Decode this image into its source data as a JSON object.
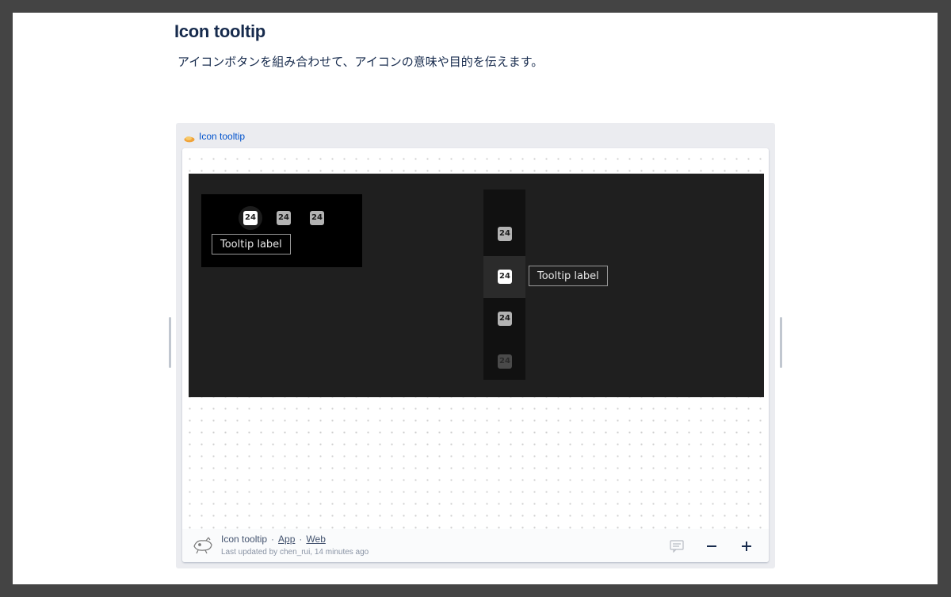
{
  "page": {
    "title": "Icon tooltip",
    "description": "アイコンボタンを組み合わせて、アイコンの意味や目的を伝えます。"
  },
  "embed": {
    "link_label": "Icon tooltip",
    "logo_icon": "figma-logo-icon"
  },
  "frame": {
    "horizontal_group": {
      "icons": [
        "24",
        "24",
        "24"
      ],
      "active_index": 0,
      "tooltip_label": "Tooltip label"
    },
    "vertical_group": {
      "icons": [
        "24",
        "24",
        "24",
        "24"
      ],
      "active_index": 1,
      "tooltip_label": "Tooltip label"
    }
  },
  "footer": {
    "title": "Icon tooltip",
    "separator": "·",
    "links": [
      "App",
      "Web"
    ],
    "meta": "Last updated by chen_rui, 14 minutes ago",
    "icons": [
      "comment-icon",
      "zoom-out-icon",
      "zoom-in-icon"
    ]
  },
  "colors": {
    "outer_background": "#444444",
    "heading": "#172b4d",
    "link": "#0052cc",
    "frame_background": "#1f1f1f"
  }
}
